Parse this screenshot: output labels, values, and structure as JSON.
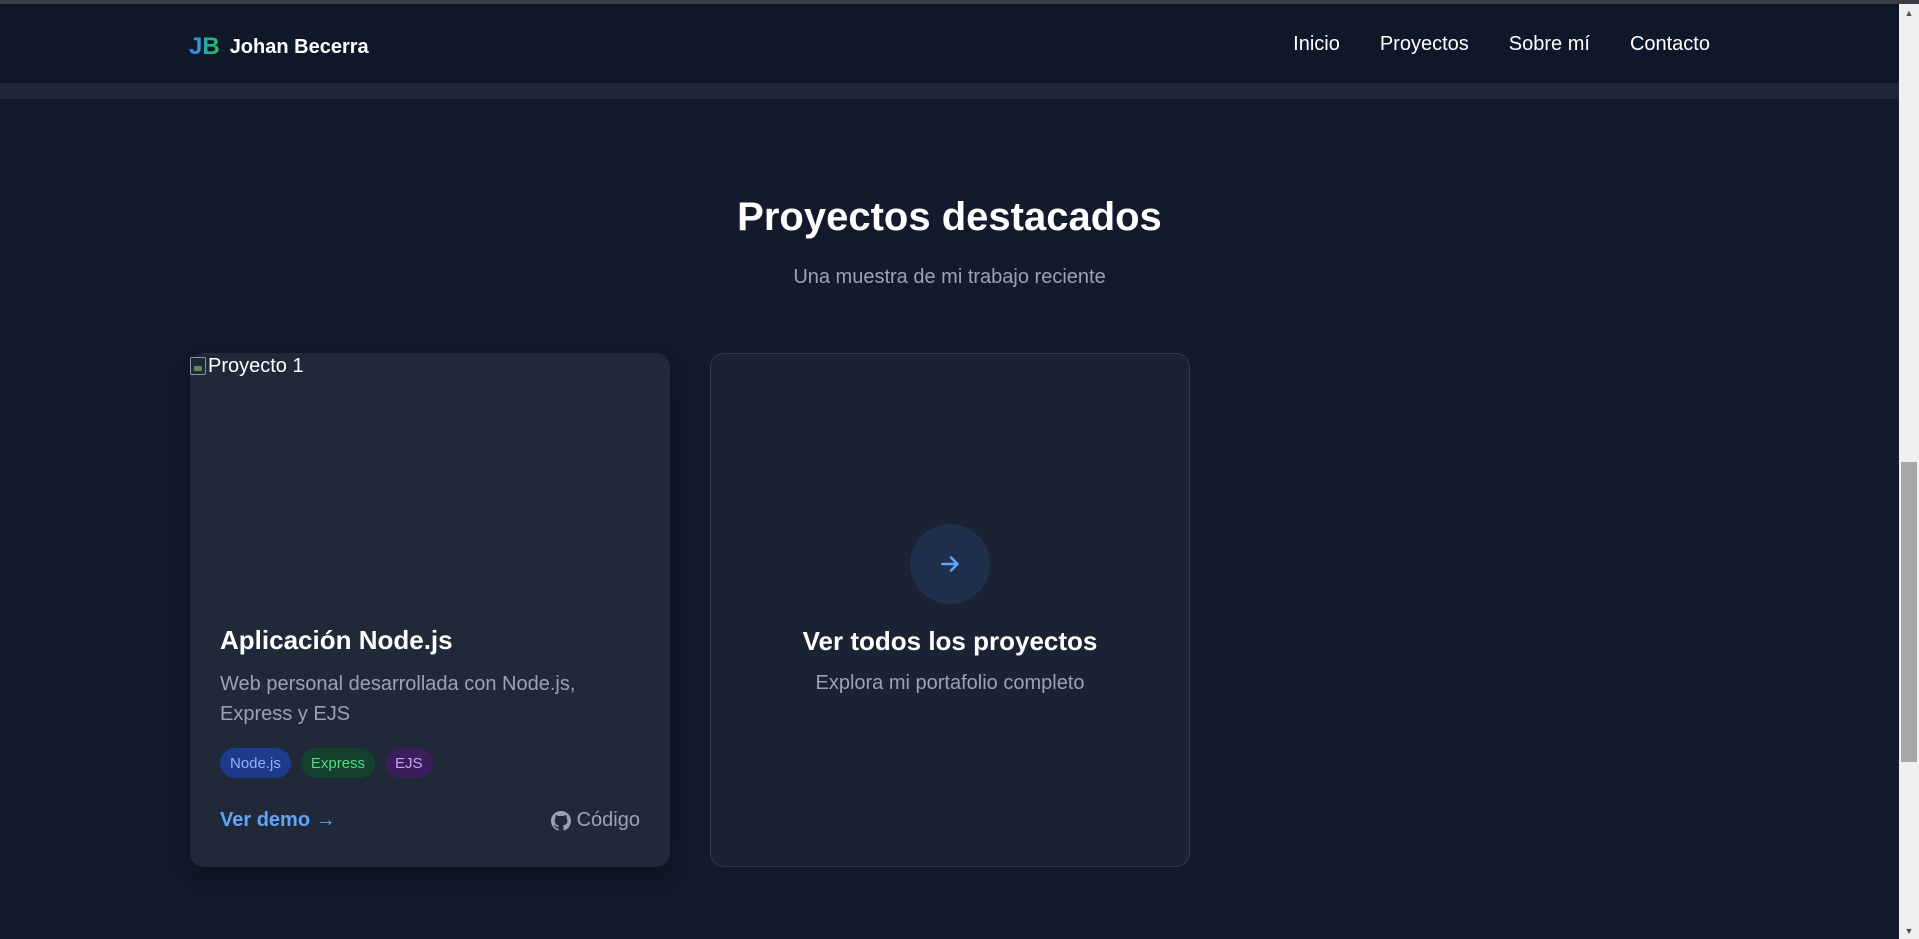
{
  "brand": {
    "mark": "JB",
    "name": "Johan Becerra"
  },
  "nav": {
    "links": [
      "Inicio",
      "Proyectos",
      "Sobre mí",
      "Contacto"
    ]
  },
  "section": {
    "title": "Proyectos destacados",
    "subtitle": "Una muestra de mi trabajo reciente"
  },
  "project_card": {
    "image_alt": "Proyecto 1",
    "title": "Aplicación Node.js",
    "description": "Web personal desarrollada con Node.js, Express y EJS",
    "tags": [
      "Node.js",
      "Express",
      "EJS"
    ],
    "demo_label": "Ver demo →",
    "code_label": "Código"
  },
  "all_projects_card": {
    "title": "Ver todos los proyectos",
    "description": "Explora mi portafolio completo",
    "icon": "arrow-right-icon"
  },
  "colors": {
    "background": "#121a2b",
    "nav_background": "#0f1829",
    "accent_blue": "#60a5fa",
    "accent_green": "#22c55e"
  }
}
